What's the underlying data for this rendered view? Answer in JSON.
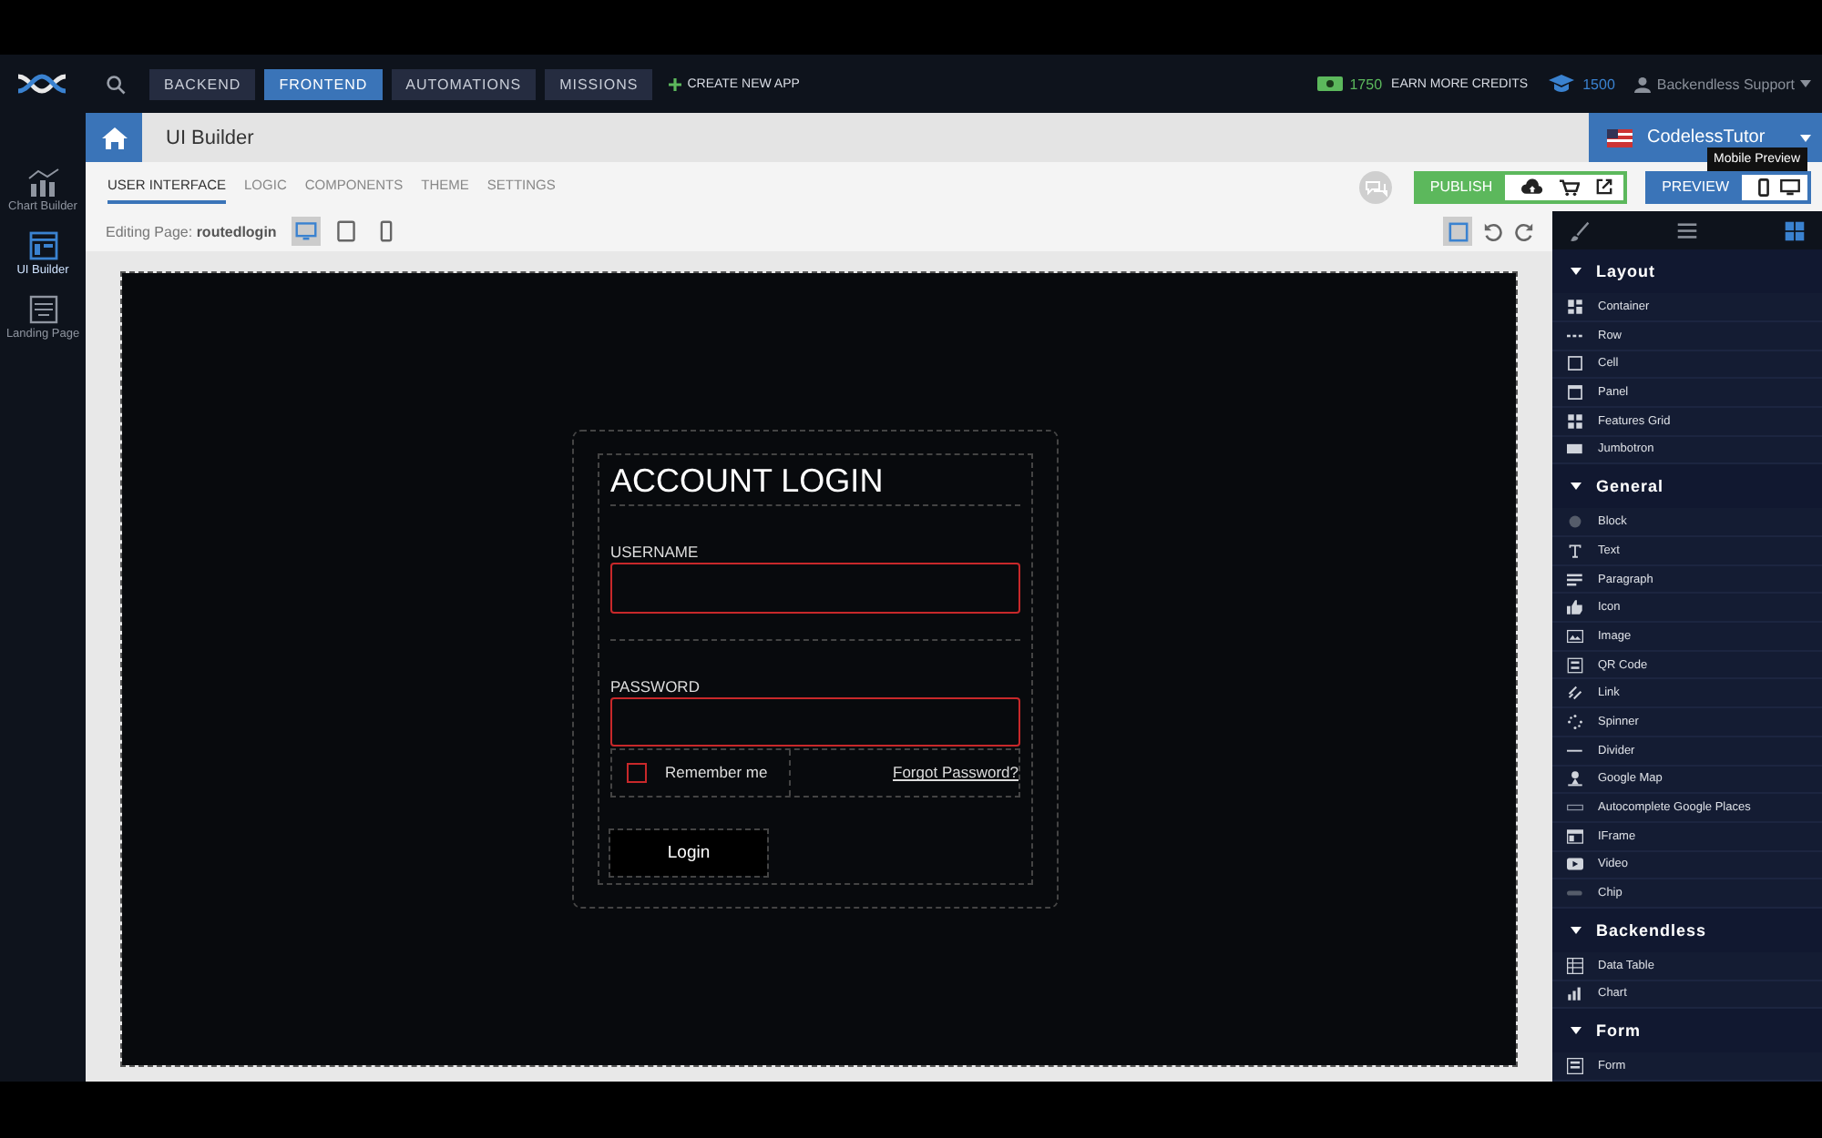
{
  "top_nav": {
    "tabs": [
      {
        "label": "BACKEND",
        "selected": false
      },
      {
        "label": "FRONTEND",
        "selected": true
      },
      {
        "label": "AUTOMATIONS",
        "selected": false
      },
      {
        "label": "MISSIONS",
        "selected": false
      }
    ],
    "create_app": "CREATE NEW APP",
    "credits": "1750",
    "earn_credits": "EARN MORE CREDITS",
    "points": "1500",
    "user": "Backendless Support"
  },
  "left_rail": [
    {
      "label": "Chart Builder",
      "selected": false
    },
    {
      "label": "UI Builder",
      "selected": true
    },
    {
      "label": "Landing Page",
      "selected": false
    }
  ],
  "header": {
    "title": "UI Builder",
    "app_name": "CodelessTutor"
  },
  "tabs": [
    {
      "label": "USER INTERFACE",
      "selected": true
    },
    {
      "label": "LOGIC",
      "selected": false
    },
    {
      "label": "COMPONENTS",
      "selected": false
    },
    {
      "label": "THEME",
      "selected": false
    },
    {
      "label": "SETTINGS",
      "selected": false
    }
  ],
  "publish": {
    "label": "PUBLISH"
  },
  "preview": {
    "label": "PREVIEW",
    "tooltip": "Mobile Preview"
  },
  "editing": {
    "label": "Editing Page:",
    "page": "routedlogin",
    "devices": [
      {
        "kind": "desktop",
        "selected": true
      },
      {
        "kind": "tablet",
        "selected": false
      },
      {
        "kind": "phone",
        "selected": false
      }
    ]
  },
  "panel_tabs": [
    {
      "kind": "brush",
      "selected": false
    },
    {
      "kind": "list",
      "selected": false
    },
    {
      "kind": "grid",
      "selected": true
    }
  ],
  "sections": [
    {
      "title": "Layout",
      "expanded": true,
      "items": [
        {
          "label": "Container",
          "kind": "container"
        },
        {
          "label": "Row",
          "kind": "row"
        },
        {
          "label": "Cell",
          "kind": "cell"
        },
        {
          "label": "Panel",
          "kind": "panel"
        },
        {
          "label": "Features Grid",
          "kind": "features-grid"
        },
        {
          "label": "Jumbotron",
          "kind": "jumbotron"
        }
      ]
    },
    {
      "title": "General",
      "expanded": true,
      "items": [
        {
          "label": "Block",
          "kind": "block"
        },
        {
          "label": "Text",
          "kind": "text"
        },
        {
          "label": "Paragraph",
          "kind": "paragraph"
        },
        {
          "label": "Icon",
          "kind": "icon"
        },
        {
          "label": "Image",
          "kind": "image"
        },
        {
          "label": "QR Code",
          "kind": "qr-code"
        },
        {
          "label": "Link",
          "kind": "link"
        },
        {
          "label": "Spinner",
          "kind": "spinner"
        },
        {
          "label": "Divider",
          "kind": "divider"
        },
        {
          "label": "Google Map",
          "kind": "google-map"
        },
        {
          "label": "Autocomplete Google Places",
          "kind": "autocomplete"
        },
        {
          "label": "IFrame",
          "kind": "iframe"
        },
        {
          "label": "Video",
          "kind": "video"
        },
        {
          "label": "Chip",
          "kind": "chip"
        }
      ]
    },
    {
      "title": "Backendless",
      "expanded": true,
      "items": [
        {
          "label": "Data Table",
          "kind": "data-table"
        },
        {
          "label": "Chart",
          "kind": "chart"
        }
      ]
    },
    {
      "title": "Form",
      "expanded": true,
      "items": [
        {
          "label": "Form",
          "kind": "form"
        }
      ]
    }
  ],
  "login_form": {
    "title": "ACCOUNT LOGIN",
    "fields": [
      {
        "label": "USERNAME"
      },
      {
        "label": "PASSWORD"
      }
    ],
    "remember": {
      "label": "Remember me",
      "checked": false
    },
    "forgot_link": "Forgot Password?",
    "button": "Login"
  }
}
